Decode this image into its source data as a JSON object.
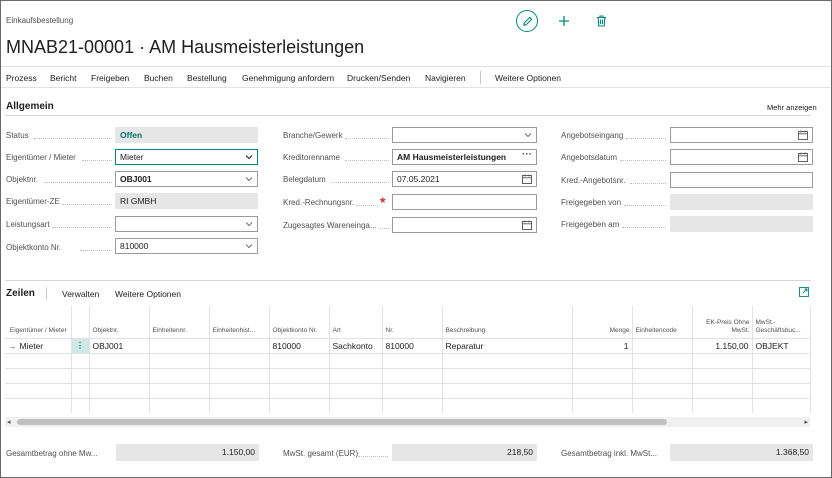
{
  "header": {
    "breadcrumb": "Einkaufsbestellung",
    "title": "MNAB21-00001 · AM Hausmeisterleistungen"
  },
  "actions": [
    "Prozess",
    "Bericht",
    "Freigeben",
    "Buchen",
    "Bestellung",
    "Genehmigung anfordern",
    "Drucken/Senden",
    "Navigieren",
    "Weitere Optionen"
  ],
  "general": {
    "title": "Allgemein",
    "show_more": "Mehr anzeigen",
    "col1": [
      {
        "label": "Status",
        "value": ""
      },
      {
        "label": "Eigentümer / Mieter",
        "value": "Mieter"
      },
      {
        "label": "Objektnr.",
        "value": "OBJ001"
      },
      {
        "label": "Eigentümer-ZE",
        "value": "RI GMBH"
      },
      {
        "label": "Leistungsart",
        "value": ""
      },
      {
        "label": "Objektkonto Nr.",
        "value": "810000"
      }
    ],
    "status_value": "Offen",
    "col2": [
      {
        "label": "Branche/Gewerk",
        "value": ""
      },
      {
        "label": "Kreditorenname",
        "value": "AM Hausmeisterleistungen"
      },
      {
        "label": "Belegdatum",
        "value": "07.05.2021"
      },
      {
        "label": "Kred.-Rechnungsnr.",
        "value": ""
      },
      {
        "label": "Zugesagtes Wareneinga...",
        "value": ""
      }
    ],
    "required_mark": "*",
    "col3": [
      {
        "label": "Angebotseingang",
        "value": ""
      },
      {
        "label": "Angebotsdatum",
        "value": ""
      },
      {
        "label": "Kred.-Angebotsnr.",
        "value": ""
      },
      {
        "label": "Freigegeben von",
        "value": ""
      },
      {
        "label": "Freigegeben am",
        "value": ""
      }
    ]
  },
  "lines": {
    "title": "Zeilen",
    "manage": "Verwalten",
    "more": "Weitere Optionen",
    "columns": [
      "Eigentümer / Mieter",
      "",
      "Objektnr.",
      "Einheitennr.",
      "Einheitenhist...",
      "Objektkonto Nr.",
      "Art",
      "Nr.",
      "Beschreibung",
      "Menge",
      "Einheitencode",
      "EK-Preis Ohne MwSt.",
      "MwSt.-Geschäftsbuc..."
    ],
    "row": [
      "Mieter",
      "",
      "OBJ001",
      "",
      "",
      "810000",
      "Sachkonto",
      "810000",
      "Reparatur",
      "1",
      "",
      "1.150,00",
      "OBJEKT"
    ],
    "row_arrow": "→"
  },
  "totals": [
    {
      "label": "Gesamtbetrag ohne Mw...",
      "value": "1.150,00"
    },
    {
      "label": "MwSt. gesamt (EUR)",
      "value": "218,50"
    },
    {
      "label": "Gesamtbetrag inkl. MwSt...",
      "value": "1.368,50"
    }
  ],
  "colors": {
    "accent": "#00897b",
    "readonly": "#e6e6e6"
  },
  "icons": [
    "edit-icon",
    "plus-icon",
    "delete-icon",
    "chevron-down-icon",
    "calendar-icon",
    "expand-icon"
  ]
}
